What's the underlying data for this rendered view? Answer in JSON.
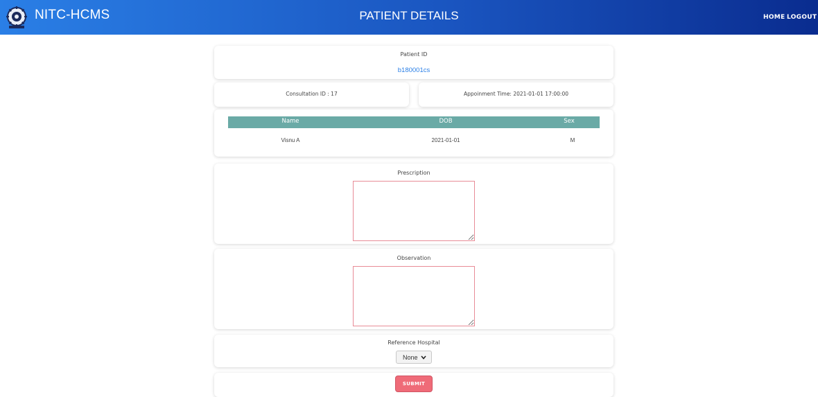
{
  "header": {
    "brand": "NITC-HCMS",
    "logo_icon": "nitc-emblem-icon",
    "title": "PATIENT DETAILS",
    "nav": {
      "home": "HOME",
      "logout": "LOGOUT"
    },
    "colors": {
      "gradient_start": "#2a7fe6",
      "gradient_end": "#0a2c8f"
    }
  },
  "patient": {
    "id_label": "Patient ID",
    "id_value": "b180001cs"
  },
  "consultation": {
    "id_text": "Consultation ID : 17",
    "appointment_text": "Appoinment Time: 2021-01-01 17:00:00"
  },
  "details_table": {
    "columns": [
      "Name",
      "DOB",
      "Sex"
    ],
    "rows": [
      [
        "Visnu A",
        "2021-01-01",
        "M"
      ]
    ],
    "header_color": "#6aaaa6"
  },
  "prescription": {
    "label": "Prescription",
    "value": ""
  },
  "observation": {
    "label": "Observation",
    "value": ""
  },
  "reference_hospital": {
    "label": "Reference Hospital",
    "selected": "None",
    "icon": "chevron-down-icon"
  },
  "submit": {
    "label": "SUBMIT",
    "color": "#ef6b78"
  }
}
